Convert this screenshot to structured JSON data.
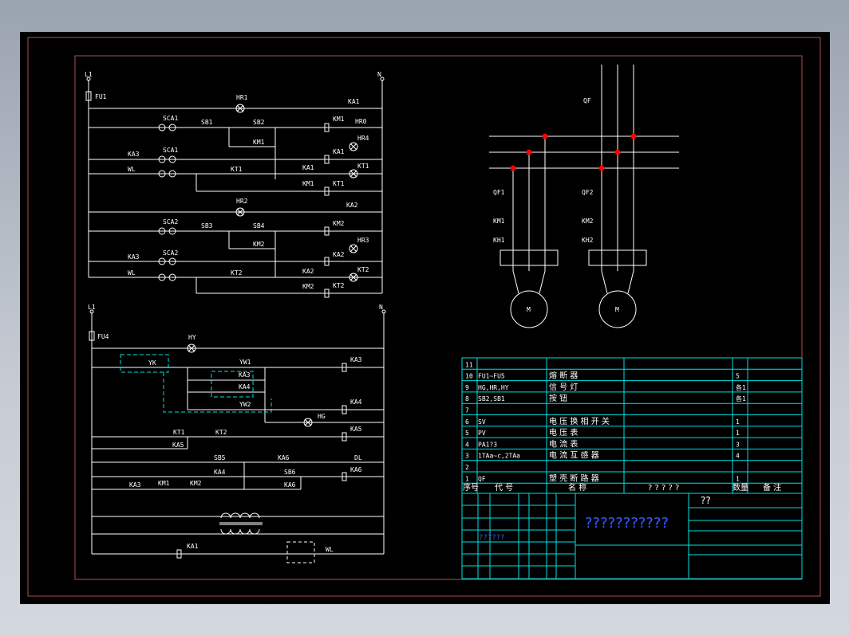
{
  "circuit_labels": {
    "L1_top": "L1",
    "N_top": "N",
    "FU1": "FU1",
    "HR1": "HR1",
    "KA1_a": "KA1",
    "SCA1_a": "SCA1",
    "SB1": "SB1",
    "SB2": "SB2",
    "KM1_a": "KM1",
    "HR0": "HR0",
    "HR4": "HR4",
    "KM1_b": "KM1",
    "KA3_a": "KA3",
    "SCA1_b": "SCA1",
    "WL_a": "WL",
    "KA1_b": "KA1",
    "KT1_a": "KT1",
    "KA1_c": "KA1",
    "KT1_b": "KT1",
    "KM1_c": "KM1",
    "KT1_c": "KT1",
    "HR2": "HR2",
    "SCA2_a": "SCA2",
    "SB3": "SB3",
    "SB4": "SB4",
    "KM2_a": "KM2",
    "KA2_a": "KA2",
    "KM2_b": "KM2",
    "HR3": "HR3",
    "KA3_b": "KA3",
    "SCA2_b": "SCA2",
    "WL_b": "WL",
    "KA2_b": "KA2",
    "KT2_a": "KT2",
    "KA2_c": "KA2",
    "KT2_b": "KT2",
    "KM2_c": "KM2",
    "KT2_c": "KT2",
    "L1_bot": "L1",
    "N_bot": "N",
    "FU4": "FU4",
    "HY": "HY",
    "YK": "YK",
    "YW1": "YW1",
    "KA3_c": "KA3",
    "KA3_d": "KA3",
    "KA4_a": "KA4",
    "YW2": "YW2",
    "KA4_b": "KA4",
    "HG": "HG",
    "KT1_d": "KT1",
    "KT2_d": "KT2",
    "KA5_a": "KA5",
    "KA5_b": "KA5",
    "SB5": "SB5",
    "KA4_c": "KA4",
    "KA6_a": "KA6",
    "DL": "DL",
    "SB6": "SB6",
    "KA6_b": "KA6",
    "KA6_c": "KA6",
    "KA3_e": "KA3",
    "KM1_d": "KM1",
    "KM2_d": "KM2",
    "KA6_d": "KA6",
    "KA1_d": "KA1",
    "WL_c": "WL",
    "QF": "QF",
    "QF1": "QF1",
    "QF2": "QF2",
    "KM1_m": "KM1",
    "KM2_m": "KM2",
    "KH1": "KH1",
    "KH2": "KH2",
    "M1": "M",
    "M2": "M"
  },
  "bom": {
    "rows": [
      {
        "no": "11",
        "code": "",
        "name": "",
        "qty": ""
      },
      {
        "no": "10",
        "code": "FU1~FU5",
        "name": "熔 断 器",
        "qty": "5"
      },
      {
        "no": "9",
        "code": "HG,HR,HY",
        "name": "信 号 灯",
        "qty": "各1"
      },
      {
        "no": "8",
        "code": "SB2,SB1",
        "name": "按 钮",
        "qty": "各1"
      },
      {
        "no": "7",
        "code": "",
        "name": "",
        "qty": ""
      },
      {
        "no": "6",
        "code": "SV",
        "name": "电 压 换 相 开 关",
        "qty": "1"
      },
      {
        "no": "5",
        "code": "PV",
        "name": "电 压 表",
        "qty": "1"
      },
      {
        "no": "4",
        "code": "PA1?3",
        "name": "电 流 表",
        "qty": "3"
      },
      {
        "no": "3",
        "code": "1TAa~c,2TAa",
        "name": "电 流 互 感 器",
        "qty": "4"
      },
      {
        "no": "2",
        "code": "",
        "name": "",
        "qty": ""
      },
      {
        "no": "1",
        "code": "QF",
        "name": "塑 壳 断 路 器",
        "qty": "1"
      }
    ],
    "header": {
      "no": "序号",
      "code": "代 号",
      "name": "名 称",
      "spec": "? ? ? ? ?",
      "qty": "数量",
      "note": "备 注"
    }
  },
  "title_block": {
    "drawing_title": "???????????",
    "small_title": "??",
    "small_code": "??????"
  }
}
